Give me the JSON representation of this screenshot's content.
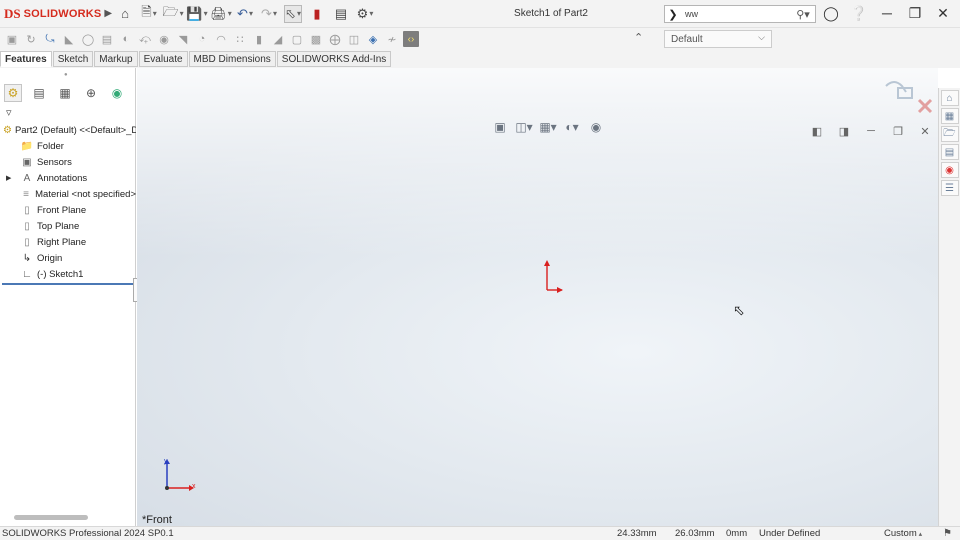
{
  "app": {
    "brand_ds": "DS",
    "brand_name": "SOLIDWORKS",
    "document_title": "Sketch1 of Part2"
  },
  "search": {
    "value": "ww"
  },
  "configuration": {
    "selected": "Default"
  },
  "tabs": [
    {
      "label": "Features",
      "active": true
    },
    {
      "label": "Sketch"
    },
    {
      "label": "Markup"
    },
    {
      "label": "Evaluate"
    },
    {
      "label": "MBD Dimensions"
    },
    {
      "label": "SOLIDWORKS Add-Ins"
    }
  ],
  "feature_tree": {
    "root": "Part2 (Default) <<Default>_D",
    "items": [
      {
        "label": "Folder",
        "icon": "folder-icon"
      },
      {
        "label": "Sensors",
        "icon": "sensor-icon"
      },
      {
        "label": "Annotations",
        "icon": "annotations-icon",
        "expandable": true
      },
      {
        "label": "Material <not specified>",
        "icon": "material-icon"
      },
      {
        "label": "Front Plane",
        "icon": "plane-icon"
      },
      {
        "label": "Top Plane",
        "icon": "plane-icon"
      },
      {
        "label": "Right Plane",
        "icon": "plane-icon"
      },
      {
        "label": "Origin",
        "icon": "origin-icon"
      },
      {
        "label": "(-) Sketch1",
        "icon": "sketch-icon"
      }
    ]
  },
  "graphics": {
    "view_orientation": "*Front",
    "triad_x": "x",
    "triad_y": "y"
  },
  "status": {
    "product": "SOLIDWORKS Professional 2024 SP0.1",
    "x": "24.33mm",
    "y": "26.03mm",
    "z": "0mm",
    "state": "Under Defined",
    "units": "Custom"
  },
  "colors": {
    "brand_red": "#d52b1e",
    "origin_red": "#d9201f",
    "triad_blue": "#2a3fbf",
    "rollback_blue": "#4b78b5"
  }
}
